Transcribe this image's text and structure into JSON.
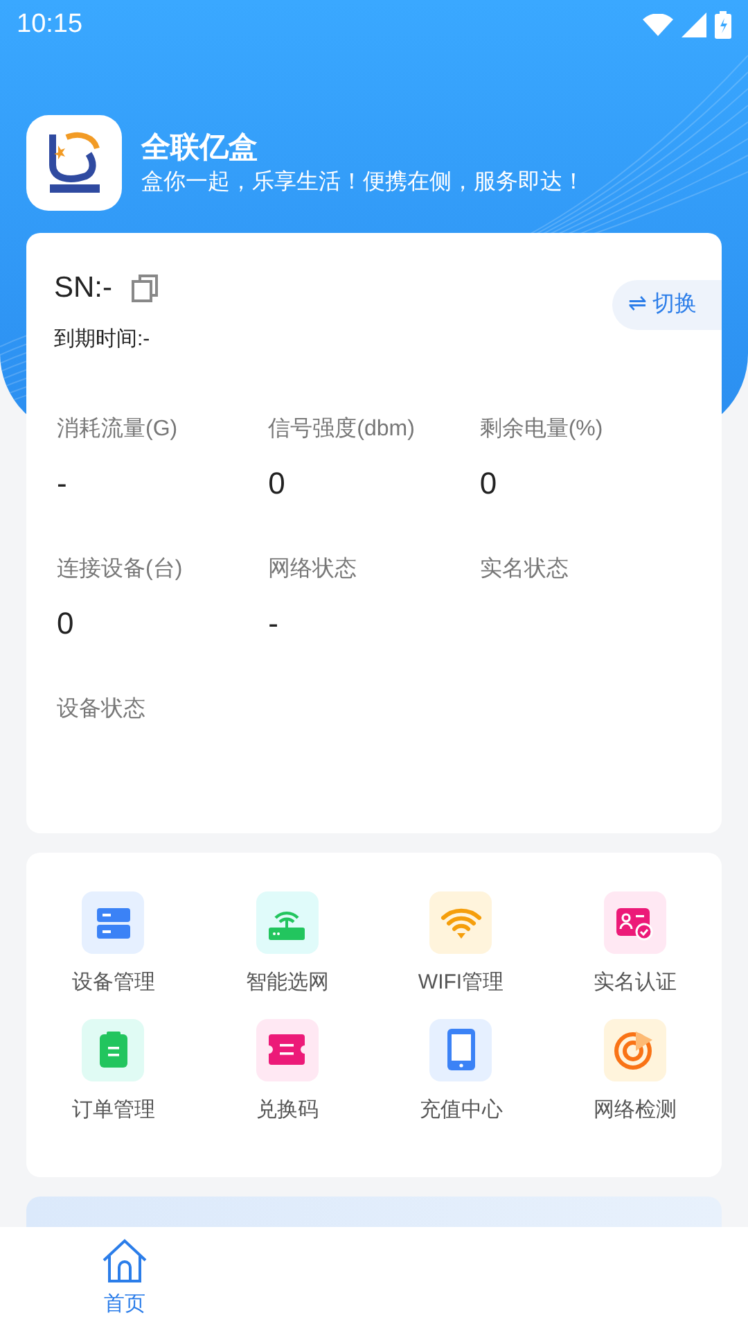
{
  "status_bar": {
    "time": "10:15"
  },
  "app": {
    "name": "全联亿盒",
    "slogan": "盒你一起，乐享生活！便携在侧，服务即达！"
  },
  "device": {
    "sn": "SN:-",
    "expiry": "到期时间:-",
    "switch_label": "⇌ 切换"
  },
  "stats": [
    {
      "label": "消耗流量(G)",
      "value": "-"
    },
    {
      "label": "信号强度(dbm)",
      "value": "0"
    },
    {
      "label": "剩余电量(%)",
      "value": "0"
    },
    {
      "label": "连接设备(台)",
      "value": "0"
    },
    {
      "label": "网络状态",
      "value": "-"
    },
    {
      "label": "实名状态"
    },
    {
      "label": "设备状态"
    }
  ],
  "menu": [
    {
      "kind": "device",
      "label": "设备管理"
    },
    {
      "kind": "router",
      "label": "智能选网"
    },
    {
      "kind": "wifi",
      "label": "WIFI管理"
    },
    {
      "kind": "realname",
      "label": "实名认证"
    },
    {
      "kind": "order",
      "label": "订单管理"
    },
    {
      "kind": "ticket",
      "label": "兑换码"
    },
    {
      "kind": "phone",
      "label": "充值中心"
    },
    {
      "kind": "radar",
      "label": "网络检测"
    }
  ],
  "tab_bar": [
    {
      "label": "首页",
      "selected": true
    }
  ]
}
